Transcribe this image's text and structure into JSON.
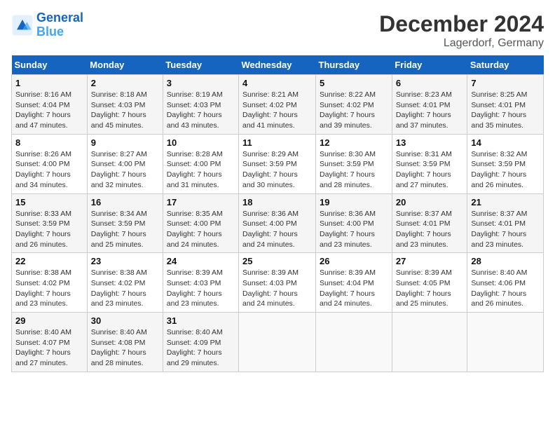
{
  "header": {
    "logo_line1": "General",
    "logo_line2": "Blue",
    "month": "December 2024",
    "location": "Lagerdorf, Germany"
  },
  "weekdays": [
    "Sunday",
    "Monday",
    "Tuesday",
    "Wednesday",
    "Thursday",
    "Friday",
    "Saturday"
  ],
  "weeks": [
    [
      {
        "day": "1",
        "detail": "Sunrise: 8:16 AM\nSunset: 4:04 PM\nDaylight: 7 hours\nand 47 minutes."
      },
      {
        "day": "2",
        "detail": "Sunrise: 8:18 AM\nSunset: 4:03 PM\nDaylight: 7 hours\nand 45 minutes."
      },
      {
        "day": "3",
        "detail": "Sunrise: 8:19 AM\nSunset: 4:03 PM\nDaylight: 7 hours\nand 43 minutes."
      },
      {
        "day": "4",
        "detail": "Sunrise: 8:21 AM\nSunset: 4:02 PM\nDaylight: 7 hours\nand 41 minutes."
      },
      {
        "day": "5",
        "detail": "Sunrise: 8:22 AM\nSunset: 4:02 PM\nDaylight: 7 hours\nand 39 minutes."
      },
      {
        "day": "6",
        "detail": "Sunrise: 8:23 AM\nSunset: 4:01 PM\nDaylight: 7 hours\nand 37 minutes."
      },
      {
        "day": "7",
        "detail": "Sunrise: 8:25 AM\nSunset: 4:01 PM\nDaylight: 7 hours\nand 35 minutes."
      }
    ],
    [
      {
        "day": "8",
        "detail": "Sunrise: 8:26 AM\nSunset: 4:00 PM\nDaylight: 7 hours\nand 34 minutes."
      },
      {
        "day": "9",
        "detail": "Sunrise: 8:27 AM\nSunset: 4:00 PM\nDaylight: 7 hours\nand 32 minutes."
      },
      {
        "day": "10",
        "detail": "Sunrise: 8:28 AM\nSunset: 4:00 PM\nDaylight: 7 hours\nand 31 minutes."
      },
      {
        "day": "11",
        "detail": "Sunrise: 8:29 AM\nSunset: 3:59 PM\nDaylight: 7 hours\nand 30 minutes."
      },
      {
        "day": "12",
        "detail": "Sunrise: 8:30 AM\nSunset: 3:59 PM\nDaylight: 7 hours\nand 28 minutes."
      },
      {
        "day": "13",
        "detail": "Sunrise: 8:31 AM\nSunset: 3:59 PM\nDaylight: 7 hours\nand 27 minutes."
      },
      {
        "day": "14",
        "detail": "Sunrise: 8:32 AM\nSunset: 3:59 PM\nDaylight: 7 hours\nand 26 minutes."
      }
    ],
    [
      {
        "day": "15",
        "detail": "Sunrise: 8:33 AM\nSunset: 3:59 PM\nDaylight: 7 hours\nand 26 minutes."
      },
      {
        "day": "16",
        "detail": "Sunrise: 8:34 AM\nSunset: 3:59 PM\nDaylight: 7 hours\nand 25 minutes."
      },
      {
        "day": "17",
        "detail": "Sunrise: 8:35 AM\nSunset: 4:00 PM\nDaylight: 7 hours\nand 24 minutes."
      },
      {
        "day": "18",
        "detail": "Sunrise: 8:36 AM\nSunset: 4:00 PM\nDaylight: 7 hours\nand 24 minutes."
      },
      {
        "day": "19",
        "detail": "Sunrise: 8:36 AM\nSunset: 4:00 PM\nDaylight: 7 hours\nand 23 minutes."
      },
      {
        "day": "20",
        "detail": "Sunrise: 8:37 AM\nSunset: 4:01 PM\nDaylight: 7 hours\nand 23 minutes."
      },
      {
        "day": "21",
        "detail": "Sunrise: 8:37 AM\nSunset: 4:01 PM\nDaylight: 7 hours\nand 23 minutes."
      }
    ],
    [
      {
        "day": "22",
        "detail": "Sunrise: 8:38 AM\nSunset: 4:02 PM\nDaylight: 7 hours\nand 23 minutes."
      },
      {
        "day": "23",
        "detail": "Sunrise: 8:38 AM\nSunset: 4:02 PM\nDaylight: 7 hours\nand 23 minutes."
      },
      {
        "day": "24",
        "detail": "Sunrise: 8:39 AM\nSunset: 4:03 PM\nDaylight: 7 hours\nand 23 minutes."
      },
      {
        "day": "25",
        "detail": "Sunrise: 8:39 AM\nSunset: 4:03 PM\nDaylight: 7 hours\nand 24 minutes."
      },
      {
        "day": "26",
        "detail": "Sunrise: 8:39 AM\nSunset: 4:04 PM\nDaylight: 7 hours\nand 24 minutes."
      },
      {
        "day": "27",
        "detail": "Sunrise: 8:39 AM\nSunset: 4:05 PM\nDaylight: 7 hours\nand 25 minutes."
      },
      {
        "day": "28",
        "detail": "Sunrise: 8:40 AM\nSunset: 4:06 PM\nDaylight: 7 hours\nand 26 minutes."
      }
    ],
    [
      {
        "day": "29",
        "detail": "Sunrise: 8:40 AM\nSunset: 4:07 PM\nDaylight: 7 hours\nand 27 minutes."
      },
      {
        "day": "30",
        "detail": "Sunrise: 8:40 AM\nSunset: 4:08 PM\nDaylight: 7 hours\nand 28 minutes."
      },
      {
        "day": "31",
        "detail": "Sunrise: 8:40 AM\nSunset: 4:09 PM\nDaylight: 7 hours\nand 29 minutes."
      },
      null,
      null,
      null,
      null
    ]
  ]
}
